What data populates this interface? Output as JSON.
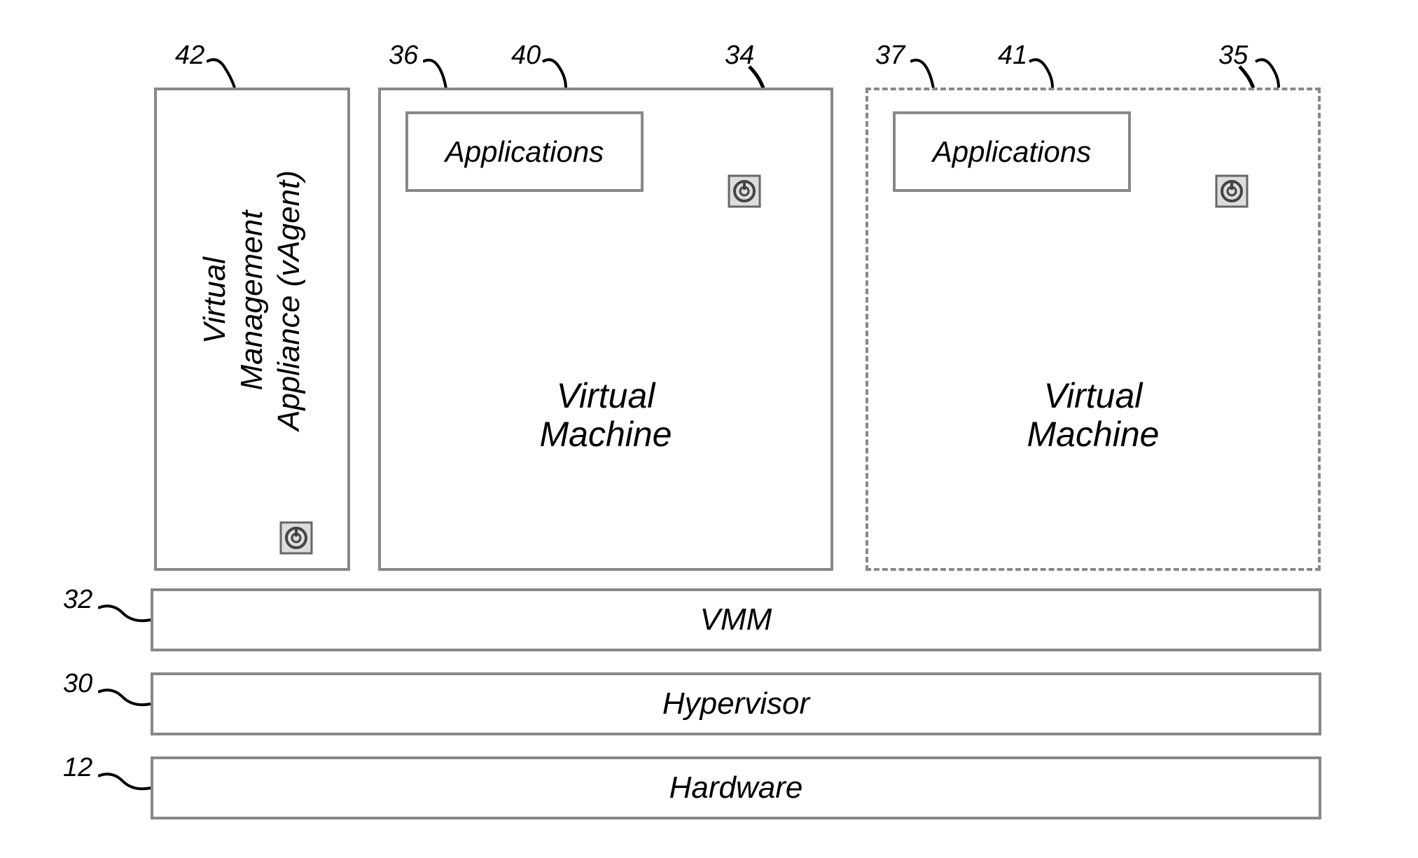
{
  "refs": {
    "r42": "42",
    "r36": "36",
    "r40": "40",
    "r34": "34",
    "r37": "37",
    "r41": "41",
    "r35": "35",
    "r32": "32",
    "r30": "30",
    "r12": "12"
  },
  "vma": {
    "label": "Virtual\nManagement\nAppliance (vAgent)"
  },
  "vm1": {
    "label": "Virtual\nMachine",
    "apps_label": "Applications"
  },
  "vm2": {
    "label": "Virtual\nMachine",
    "apps_label": "Applications"
  },
  "layers": {
    "vmm": "VMM",
    "hypervisor": "Hypervisor",
    "hardware": "Hardware"
  }
}
